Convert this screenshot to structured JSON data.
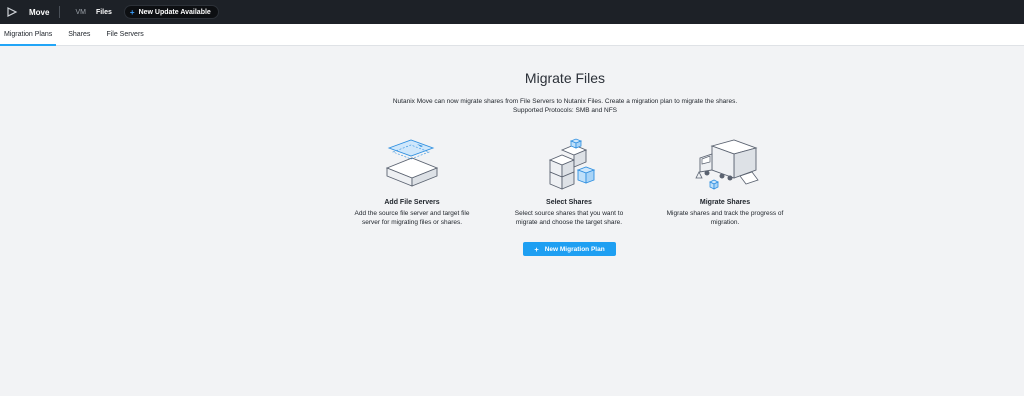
{
  "header": {
    "app_name": "Move",
    "nav": [
      {
        "label": "VM",
        "active": false
      },
      {
        "label": "Files",
        "active": true
      }
    ],
    "update_badge": {
      "icon": "plus",
      "label": "New Update Available"
    }
  },
  "tabs": [
    {
      "label": "Migration Plans",
      "active": true
    },
    {
      "label": "Shares",
      "active": false
    },
    {
      "label": "File Servers",
      "active": false
    }
  ],
  "main": {
    "title": "Migrate Files",
    "description_line1": "Nutanix Move can now migrate shares from File Servers to Nutanix Files. Create a migration plan to migrate the shares.",
    "description_line2": "Supported Protocols: SMB and NFS",
    "steps": [
      {
        "icon": "file-servers-illustration",
        "title": "Add File Servers",
        "desc_line1": "Add the source file server and target file",
        "desc_line2": "server for migrating files or shares."
      },
      {
        "icon": "select-shares-illustration",
        "title": "Select Shares",
        "desc_line1": "Select source shares that you want to",
        "desc_line2": "migrate and choose the target share."
      },
      {
        "icon": "migrate-truck-illustration",
        "title": "Migrate Shares",
        "desc_line1": "Migrate shares and track the progress of",
        "desc_line2": "migration."
      }
    ],
    "cta_label": "New Migration Plan"
  },
  "colors": {
    "topbar": "#1d2127",
    "accent": "#1e9ff2",
    "background": "#f2f3f5"
  }
}
